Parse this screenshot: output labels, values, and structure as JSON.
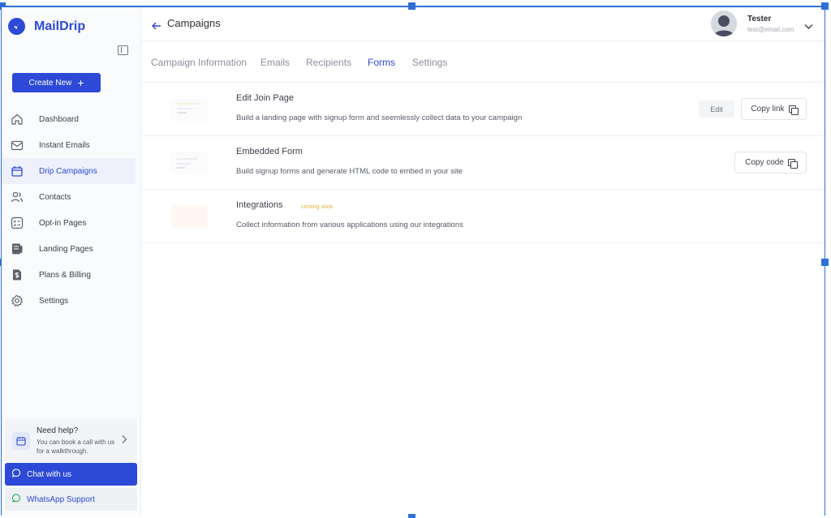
{
  "brand": {
    "name": "MailDrip",
    "color": "#2c49d8"
  },
  "sidebar": {
    "create_label": "Create New",
    "items": [
      {
        "label": "Dashboard",
        "icon": "home-icon"
      },
      {
        "label": "Instant Emails",
        "icon": "mail-icon"
      },
      {
        "label": "Drip Campaigns",
        "icon": "box-icon",
        "active": true
      },
      {
        "label": "Contacts",
        "icon": "users-icon"
      },
      {
        "label": "Opt-in Pages",
        "icon": "checklist-icon"
      },
      {
        "label": "Landing Pages",
        "icon": "pages-icon"
      },
      {
        "label": "Plans & Billing",
        "icon": "billing-icon"
      },
      {
        "label": "Settings",
        "icon": "gear-icon"
      }
    ],
    "help": {
      "title": "Need help?",
      "subtitle": "You can book a call with us for a walkthrough."
    },
    "chat_label": "Chat with us",
    "whatsapp_label": "WhatsApp Support"
  },
  "header": {
    "title": "Campaigns",
    "user": {
      "name": "Tester",
      "email": "test@email.com"
    }
  },
  "tabs": [
    {
      "label": "Campaign Information"
    },
    {
      "label": "Emails"
    },
    {
      "label": "Recipients"
    },
    {
      "label": "Forms",
      "active": true
    },
    {
      "label": "Settings"
    }
  ],
  "forms": [
    {
      "title": "Edit Join Page",
      "description": "Build a landing page with signup form and seemlessly collect data to your campaign",
      "edit_label": "Edit",
      "copy_label": "Copy link"
    },
    {
      "title": "Embedded Form",
      "description": "Build signup forms and generate HTML code to embed in your site",
      "copy_label": "Copy code"
    },
    {
      "title": "Integrations",
      "badge": "coming soon",
      "description": "Collect information from various applications using our integrations"
    }
  ]
}
